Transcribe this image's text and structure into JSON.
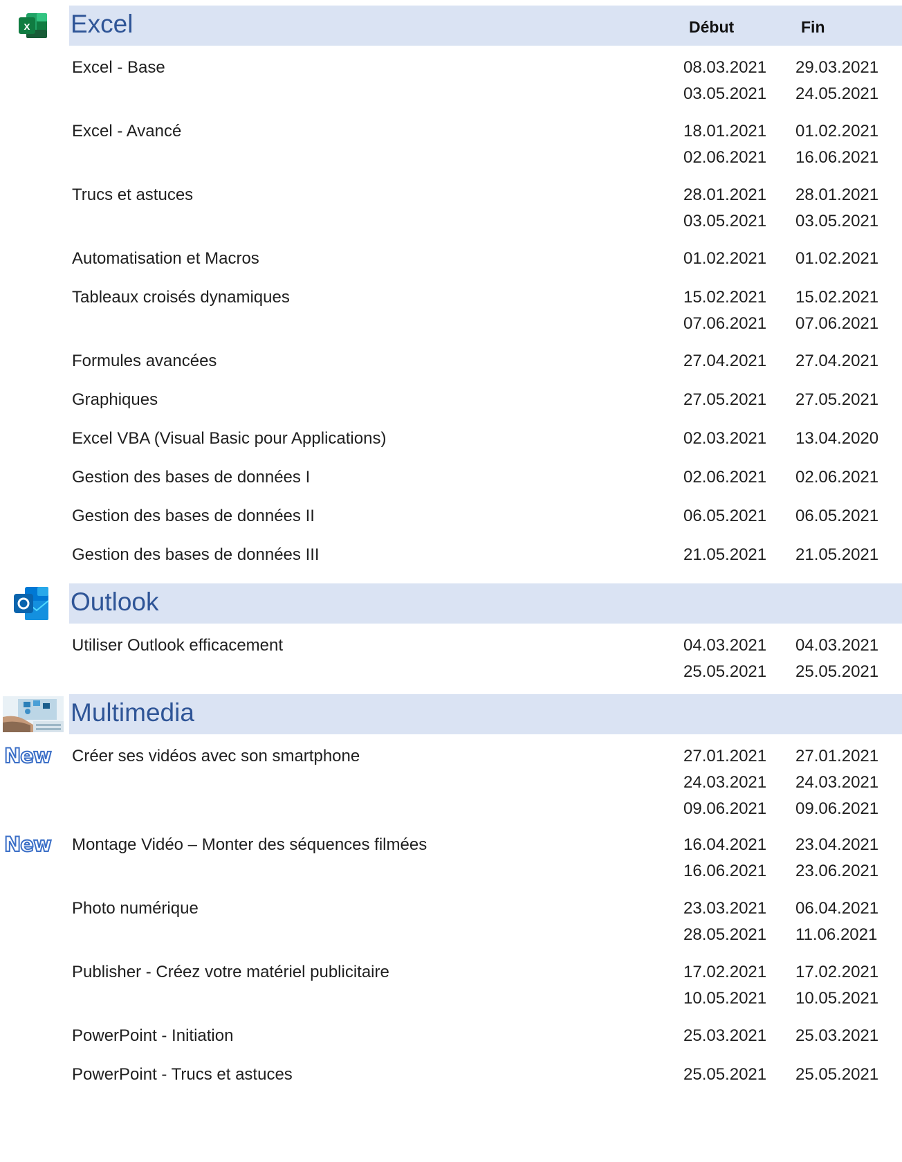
{
  "columns": {
    "debut": "Début",
    "fin": "Fin"
  },
  "badge_new": "New",
  "sections": [
    {
      "title": "Excel",
      "icon": "excel-icon",
      "courses": [
        {
          "name": "Excel - Base",
          "dates": [
            [
              "08.03.2021",
              "29.03.2021"
            ],
            [
              "03.05.2021",
              "24.05.2021"
            ]
          ]
        },
        {
          "name": "Excel - Avancé",
          "dates": [
            [
              "18.01.2021",
              "01.02.2021"
            ],
            [
              "02.06.2021",
              "16.06.2021"
            ]
          ]
        },
        {
          "name": "Trucs et astuces",
          "dates": [
            [
              "28.01.2021",
              "28.01.2021"
            ],
            [
              "03.05.2021",
              "03.05.2021"
            ]
          ]
        },
        {
          "name": "Automatisation et Macros",
          "dates": [
            [
              "01.02.2021",
              "01.02.2021"
            ]
          ]
        },
        {
          "name": "Tableaux croisés dynamiques",
          "dates": [
            [
              "15.02.2021",
              "15.02.2021"
            ],
            [
              "07.06.2021",
              "07.06.2021"
            ]
          ]
        },
        {
          "name": "Formules avancées",
          "dates": [
            [
              "27.04.2021",
              "27.04.2021"
            ]
          ]
        },
        {
          "name": "Graphiques",
          "dates": [
            [
              "27.05.2021",
              "27.05.2021"
            ]
          ]
        },
        {
          "name": "Excel VBA (Visual Basic pour Applications)",
          "dates": [
            [
              "02.03.2021",
              "13.04.2020"
            ]
          ]
        },
        {
          "name": "Gestion des bases de données I",
          "dates": [
            [
              "02.06.2021",
              "02.06.2021"
            ]
          ]
        },
        {
          "name": "Gestion des bases de données II",
          "dates": [
            [
              "06.05.2021",
              "06.05.2021"
            ]
          ]
        },
        {
          "name": "Gestion des bases de données III",
          "dates": [
            [
              "21.05.2021",
              "21.05.2021"
            ]
          ]
        }
      ]
    },
    {
      "title": "Outlook",
      "icon": "outlook-icon",
      "courses": [
        {
          "name": "Utiliser Outlook efficacement",
          "dates": [
            [
              "04.03.2021",
              "04.03.2021"
            ],
            [
              "25.05.2021",
              "25.05.2021"
            ]
          ]
        }
      ]
    },
    {
      "title": "Multimedia",
      "icon": "multimedia-photo-icon",
      "courses": [
        {
          "name": "Créer ses vidéos avec son smartphone",
          "new": true,
          "dates": [
            [
              "27.01.2021",
              "27.01.2021"
            ],
            [
              "24.03.2021",
              "24.03.2021"
            ],
            [
              "09.06.2021",
              "09.06.2021"
            ]
          ]
        },
        {
          "name": "Montage Vidéo – Monter des séquences filmées",
          "new": true,
          "dates": [
            [
              "16.04.2021",
              "23.04.2021"
            ],
            [
              "16.06.2021",
              "23.06.2021"
            ]
          ]
        },
        {
          "name": "Photo numérique",
          "dates": [
            [
              "23.03.2021",
              "06.04.2021"
            ],
            [
              "28.05.2021",
              "11.06.2021"
            ]
          ]
        },
        {
          "name": "Publisher - Créez votre matériel publicitaire",
          "dates": [
            [
              "17.02.2021",
              "17.02.2021"
            ],
            [
              "10.05.2021",
              "10.05.2021"
            ]
          ]
        },
        {
          "name": "PowerPoint - Initiation",
          "dates": [
            [
              "25.03.2021",
              "25.03.2021"
            ]
          ]
        },
        {
          "name": "PowerPoint - Trucs et astuces",
          "dates": [
            [
              "25.05.2021",
              "25.05.2021"
            ]
          ]
        }
      ]
    }
  ]
}
